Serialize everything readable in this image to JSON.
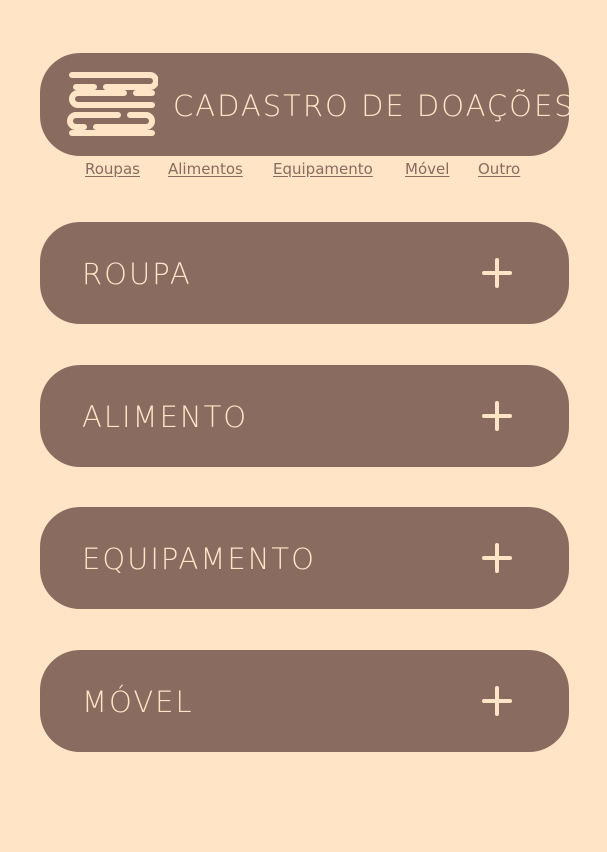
{
  "header": {
    "title": "CADASTRO DE DOAÇÕES",
    "logo_icon": "maze-logo-icon"
  },
  "nav": {
    "items": [
      {
        "label": "Roupas"
      },
      {
        "label": "Alimentos"
      },
      {
        "label": "Equipamento"
      },
      {
        "label": "Móvel"
      },
      {
        "label": "Outro"
      }
    ]
  },
  "categories": [
    {
      "label": "ROUPA",
      "icon": "plus-icon"
    },
    {
      "label": "ALIMENTO",
      "icon": "plus-icon"
    },
    {
      "label": "EQUIPAMENTO",
      "icon": "plus-icon"
    },
    {
      "label": "MÓVEL",
      "icon": "plus-icon"
    }
  ],
  "colors": {
    "background": "#ffe4c6",
    "card": "#8a6b60",
    "text_light": "#ffe4c6"
  }
}
